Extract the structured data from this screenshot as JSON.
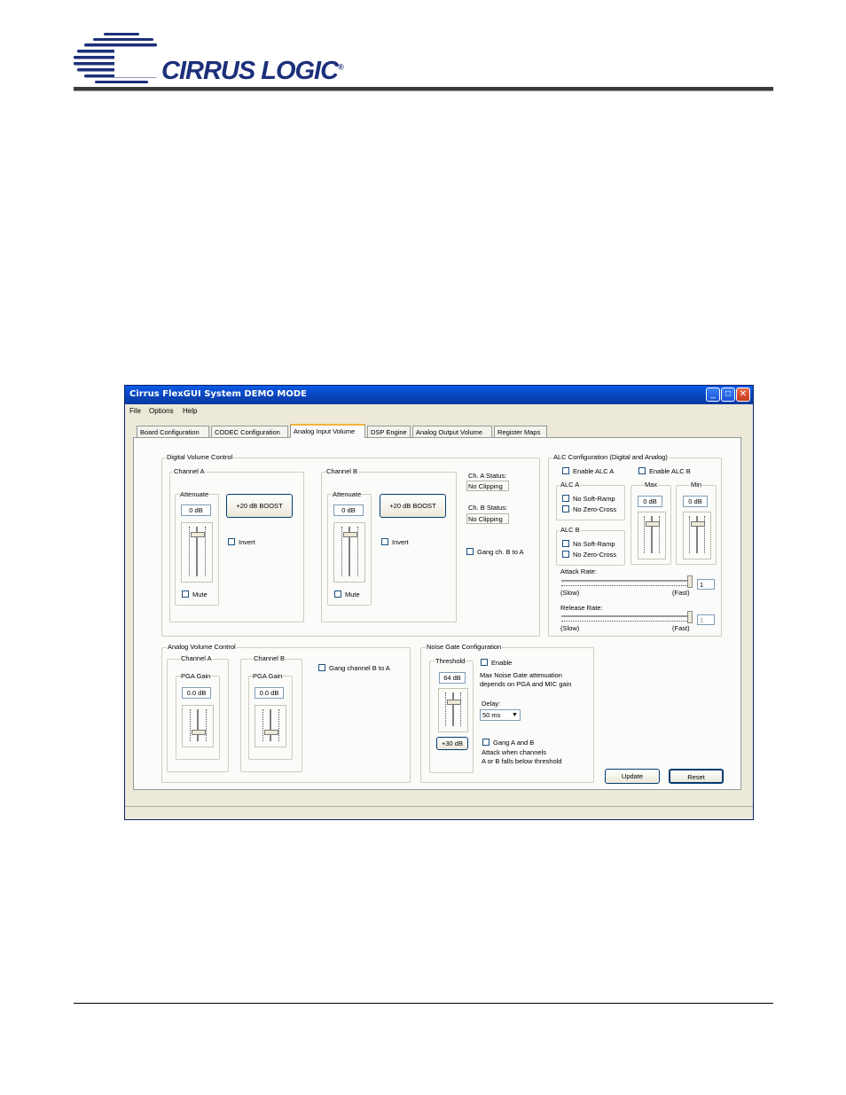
{
  "header": {
    "brand": "CIRRUS LOGIC",
    "brand_mark": "®"
  },
  "window": {
    "title": "Cirrus FlexGUI System DEMO MODE",
    "controls": {
      "minimize": "_",
      "maximize": "□",
      "close": "✕"
    }
  },
  "menu": {
    "file": "File",
    "options": "Options",
    "help": "Help"
  },
  "tabs": [
    "Board Configuration",
    "CODEC Configuration",
    "Analog Input Volume",
    "DSP Engine",
    "Analog Output Volume",
    "Register Maps"
  ],
  "digital_volume": {
    "title": "Digital Volume Control",
    "channel_a": {
      "title": "Channel A",
      "attenuate_label": "Attenuate",
      "value": "0 dB",
      "boost": "+20 dB BOOST",
      "invert": "Invert",
      "mute": "Mute"
    },
    "channel_b": {
      "title": "Channel B",
      "attenuate_label": "Attenuate",
      "value": "0 dB",
      "boost": "+20 dB BOOST",
      "invert": "Invert",
      "mute": "Mute"
    },
    "status_a_label": "Ch. A Status:",
    "status_a_value": "No Clipping",
    "status_b_label": "Ch. B Status:",
    "status_b_value": "No Clipping",
    "gang": "Gang ch. B to A"
  },
  "alc": {
    "title": "ALC Configuration (Digital and Analog)",
    "enable_a": "Enable ALC A",
    "enable_b": "Enable ALC B",
    "alc_a": {
      "title": "ALC A",
      "soft_ramp": "No Soft-Ramp",
      "zero_cross": "No Zero-Cross"
    },
    "alc_b": {
      "title": "ALC B",
      "soft_ramp": "No Soft-Ramp",
      "zero_cross": "No Zero-Cross"
    },
    "max": {
      "title": "Max",
      "value": "0 dB"
    },
    "min": {
      "title": "Min",
      "value": "0 dB"
    },
    "attack": {
      "label": "Attack Rate:",
      "value": "1",
      "slow": "(Slow)",
      "fast": "(Fast)",
      "level": 1.0
    },
    "release": {
      "label": "Release Rate:",
      "value": "1",
      "slow": "(Slow)",
      "fast": "(Fast)",
      "level": 1.0
    }
  },
  "analog_volume": {
    "title": "Analog Volume Control",
    "channel_a": {
      "title": "Channel A",
      "gain_label": "PGA Gain",
      "value": "0.0 dB"
    },
    "channel_b": {
      "title": "Channel B",
      "gain_label": "PGA Gain",
      "value": "0.0 dB"
    },
    "gang": "Gang channel B to A"
  },
  "noise_gate": {
    "title": "Noise Gate Configuration",
    "threshold_label": "Threshold",
    "threshold_value": "64 dB",
    "boost_label": "+30 dB",
    "enable": "Enable",
    "note_line1": "Max Noise Gate attenuation",
    "note_line2": "depends on PGA and MIC gain",
    "delay_label": "Delay:",
    "delay_value": "50 ms",
    "gang": "Gang A and B",
    "attack_line1": "Attack when channels",
    "attack_line2": "A or B falls below threshold"
  },
  "buttons": {
    "update": "Update",
    "reset": "Reset"
  },
  "colors": {
    "titlebar": "#0a5ae8",
    "brand": "#1c2f7a",
    "window_bg": "#ece9d8"
  }
}
